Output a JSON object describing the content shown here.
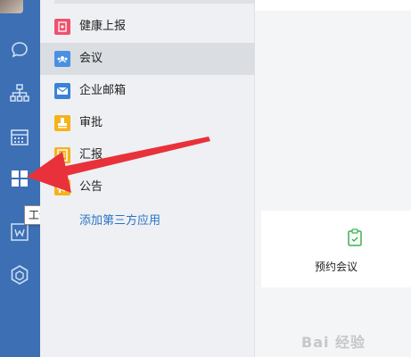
{
  "sidebar": {
    "items": [
      {
        "name": "chat",
        "icon": "chat-bubble-icon"
      },
      {
        "name": "contacts",
        "icon": "org-chart-icon"
      },
      {
        "name": "calendar",
        "icon": "calendar-icon"
      },
      {
        "name": "workbench",
        "icon": "grid-icon"
      },
      {
        "name": "docs",
        "icon": "w-doc-icon"
      },
      {
        "name": "apps",
        "icon": "hexagon-icon"
      }
    ],
    "tooltip": "工作台"
  },
  "apps": {
    "items": [
      {
        "label": "健康上报",
        "icon": "health-report-icon",
        "color": "#f0506e"
      },
      {
        "label": "会议",
        "icon": "meeting-icon",
        "color": "#4a90e2"
      },
      {
        "label": "企业邮箱",
        "icon": "mail-icon",
        "color": "#3b82d6"
      },
      {
        "label": "审批",
        "icon": "approval-icon",
        "color": "#f5b31b"
      },
      {
        "label": "汇报",
        "icon": "report-icon",
        "color": "#f5b31b"
      },
      {
        "label": "公告",
        "icon": "announcement-icon",
        "color": "#f5b31b"
      }
    ],
    "selected_index": 1,
    "add_link": "添加第三方应用"
  },
  "right_panel": {
    "card": {
      "label": "预约会议",
      "icon": "clipboard-icon",
      "color": "#3bb24e"
    }
  },
  "watermark": "Bai 经验",
  "annotation": {
    "color": "#e8313a"
  }
}
